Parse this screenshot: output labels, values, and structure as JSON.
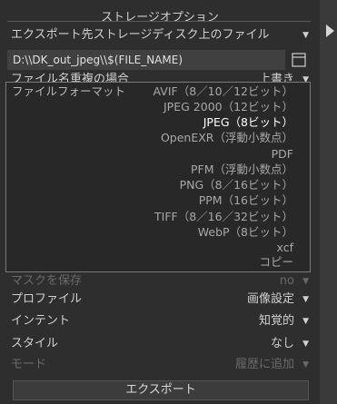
{
  "section_title": "ストレージオプション",
  "storage_row": {
    "label": "エクスポート先ストレージディスク上のファイル",
    "caret": "▼"
  },
  "path": {
    "value": "D:\\\\DK_out_jpeg\\\\$(FILE_NAME)"
  },
  "overwrite_row": {
    "label": "ファイル名重複の場合",
    "value": "上書き",
    "caret": "▼"
  },
  "format_dropdown": {
    "header": "ファイルフォーマット",
    "options": [
      "AVIF（8／10／12ビット）",
      "JPEG 2000（12ビット）",
      "JPEG（8ビット）",
      "OpenEXR（浮動小数点）",
      "PDF",
      "PFM（浮動小数点）",
      "PNG（8／16ビット）",
      "PPM（16ビット）",
      "TIFF（8／16／32ビット）",
      "WebP（8ビット）",
      "xcf",
      "コピー"
    ],
    "selected": "JPEG（8ビット）"
  },
  "rows": {
    "save_mask": {
      "label": "マスクを保存",
      "value": "no",
      "caret": "▼"
    },
    "profile": {
      "label": "プロファイル",
      "value": "画像設定",
      "caret": "▼"
    },
    "intent": {
      "label": "インテント",
      "value": "知覚的",
      "caret": "▼"
    },
    "style": {
      "label": "スタイル",
      "value": "なし",
      "caret": "▼"
    },
    "mode": {
      "label": "モード",
      "value": "履歴に追加",
      "caret": "▼"
    }
  },
  "export_button": "エクスポート"
}
